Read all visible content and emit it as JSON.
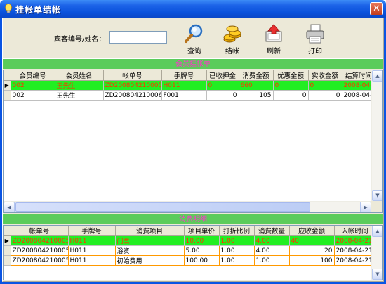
{
  "window": {
    "title": "挂帐单结帐",
    "close_glyph": "✕"
  },
  "search": {
    "label": "宾客编号/姓名：",
    "value": ""
  },
  "toolbar": [
    {
      "label": "查询",
      "icon": "magnifier-icon"
    },
    {
      "label": "结帐",
      "icon": "coins-icon"
    },
    {
      "label": "刷新",
      "icon": "refresh-icon"
    },
    {
      "label": "打印",
      "icon": "printer-icon"
    }
  ],
  "bills": {
    "section_title": "会员挂帐单",
    "columns": [
      "会员编号",
      "会员姓名",
      "帐单号",
      "手牌号",
      "已收押金",
      "消费金额",
      "优惠金额",
      "实收金额",
      "结算时间"
    ],
    "rows": [
      [
        "002",
        "王先生",
        "ZD200804210005",
        "H011",
        "0",
        "660",
        "0",
        "0",
        "2008-04-2"
      ],
      [
        "002",
        "王先生",
        "ZD200804210006",
        "F001",
        "0",
        "105",
        "0",
        "0",
        "2008-04-2"
      ]
    ],
    "current_row_marker": "▶"
  },
  "details": {
    "section_title": "消费明细",
    "columns": [
      "帐单号",
      "手牌号",
      "消费项目",
      "项目单价",
      "打折比例",
      "消费数量",
      "应收金额",
      "入帐时间"
    ],
    "rows": [
      [
        "ZD200804210005",
        "H011",
        "门票",
        "10.00",
        "1.00",
        "4.00",
        "40",
        "2008-04-21 2"
      ],
      [
        "ZD200804210005",
        "H011",
        "浴资",
        "5.00",
        "1.00",
        "4.00",
        "20",
        "2008-04-21 2"
      ],
      [
        "ZD200804210005",
        "H011",
        "初始费用",
        "100.00",
        "1.00",
        "1.00",
        "100",
        "2008-04-21 2"
      ]
    ],
    "current_row_marker": "▶"
  },
  "colors": {
    "title_bar": "#0a52dc",
    "section_bar": "#5bcc5b",
    "section_text": "#ff33cc",
    "selected_row": "#22ee22",
    "selected_text": "#ff3300"
  }
}
